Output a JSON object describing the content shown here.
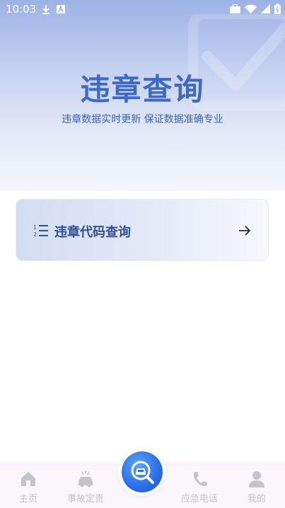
{
  "status_bar": {
    "time": "10:03",
    "left_icons": [
      "download-icon",
      "a-icon"
    ],
    "right_icons": [
      "briefcase-icon",
      "wifi-icon",
      "signal-icon",
      "battery-icon"
    ]
  },
  "hero": {
    "title": "违章查询",
    "subtitle": "违章数据实时更新  保证数据准确专业"
  },
  "menu": {
    "card_label": "违章代码查询",
    "card_icon": "numbered-list-icon",
    "arrow_icon": "arrow-right-icon"
  },
  "tabbar": {
    "items": [
      {
        "label": "主页",
        "icon": "home-icon"
      },
      {
        "label": "事故定责",
        "icon": "car-accident-icon"
      },
      {
        "label": "",
        "icon": "car-search-icon"
      },
      {
        "label": "应急电话",
        "icon": "phone-icon"
      },
      {
        "label": "我的",
        "icon": "user-icon"
      }
    ]
  },
  "colors": {
    "accent": "#3f69c7",
    "tab_inactive": "#c4c4c8",
    "center_button": "#2a6ee6"
  }
}
